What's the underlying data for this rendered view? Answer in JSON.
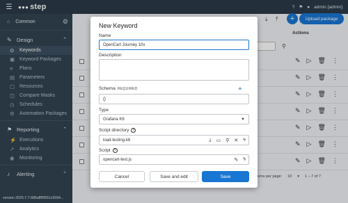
{
  "app": {
    "logo": "step",
    "user": "admin [admin]"
  },
  "sidebar": {
    "project": "Common",
    "sections": [
      {
        "title": "Design",
        "items": [
          "Keywords",
          "Keyword Packages",
          "Plans",
          "Parameters",
          "Resources",
          "Compare Masks",
          "Schedules",
          "Automation Packages"
        ]
      },
      {
        "title": "Reporting",
        "items": [
          "Executions",
          "Analytics",
          "Monitoring"
        ]
      },
      {
        "title": "Alerting",
        "items": []
      }
    ],
    "version": "version 2025.7.7-686afff0f551c5594..."
  },
  "background": {
    "upload_label": "Upload package",
    "actions_header": "Actions",
    "pager": {
      "items_per_page_label": "Items per page:",
      "per_page": "10",
      "range": "1 – 7 of 7"
    }
  },
  "dialog": {
    "title": "New Keyword",
    "name_label": "Name",
    "name_value": "OpenCart Journey 10x",
    "description_label": "Description",
    "description_value": "",
    "schema_label": "Schema",
    "schema_required": "REQUIRED",
    "schema_value": "{}",
    "type_label": "Type",
    "type_value": "Grafana K6",
    "script_dir_label": "Script directory",
    "script_dir_value": "load-testing-k6",
    "script_label": "Script",
    "script_value": "opencart-test.js",
    "cancel_label": "Cancel",
    "save_edit_label": "Save and edit",
    "save_label": "Save"
  }
}
